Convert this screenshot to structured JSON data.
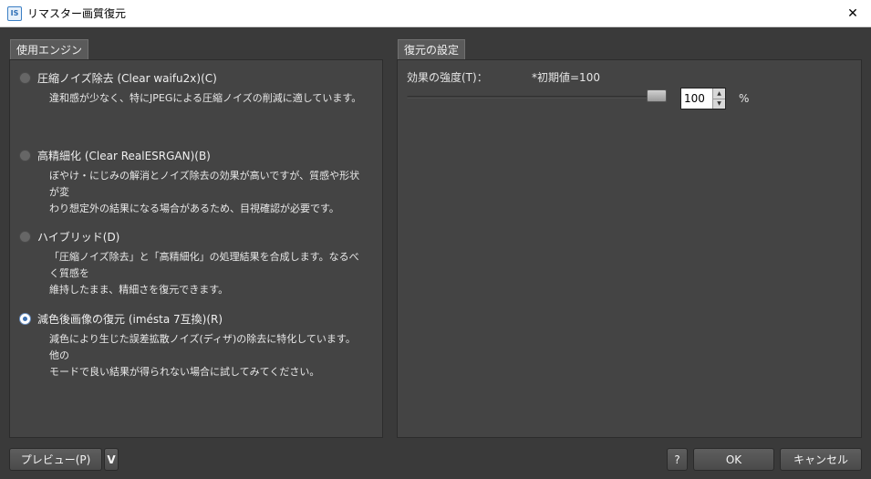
{
  "window": {
    "icon_text": "IS",
    "title": "リマスター画質復元",
    "close_glyph": "✕"
  },
  "engine_panel": {
    "tab_label": "使用エンジン",
    "options": [
      {
        "label": "圧縮ノイズ除去 (Clear waifu2x)(C)",
        "desc_lines": [
          "違和感が少なく、特にJPEGによる圧縮ノイズの削減に適しています。"
        ],
        "checked": false
      },
      {
        "label": "高精細化 (Clear RealESRGAN)(B)",
        "desc_lines": [
          "ぼやけ・にじみの解消とノイズ除去の効果が高いですが、質感や形状が変",
          "わり想定外の結果になる場合があるため、目視確認が必要です。"
        ],
        "checked": false
      },
      {
        "label": "ハイブリッド(D)",
        "desc_lines": [
          "「圧縮ノイズ除去」と「高精細化」の処理結果を合成します。なるべく質感を",
          "維持したまま、精細さを復元できます。"
        ],
        "checked": false
      },
      {
        "label": "減色後画像の復元 (iméstа 7互換)(R)",
        "desc_lines": [
          "減色により生じた誤差拡散ノイズ(ディザ)の除去に特化しています。他の",
          "モードで良い結果が得られない場合に試してみてください。"
        ],
        "checked": true
      }
    ]
  },
  "settings_panel": {
    "tab_label": "復元の設定",
    "strength_label": "効果の強度(T)：",
    "default_note": "*初期値=100",
    "strength_value": "100",
    "slider_level": 100,
    "unit": "%"
  },
  "footer": {
    "preview_label": "プレビュー(P)",
    "preview_dropdown": "V",
    "help_label": "?",
    "ok_label": "OK",
    "cancel_label": "キャンセル"
  }
}
